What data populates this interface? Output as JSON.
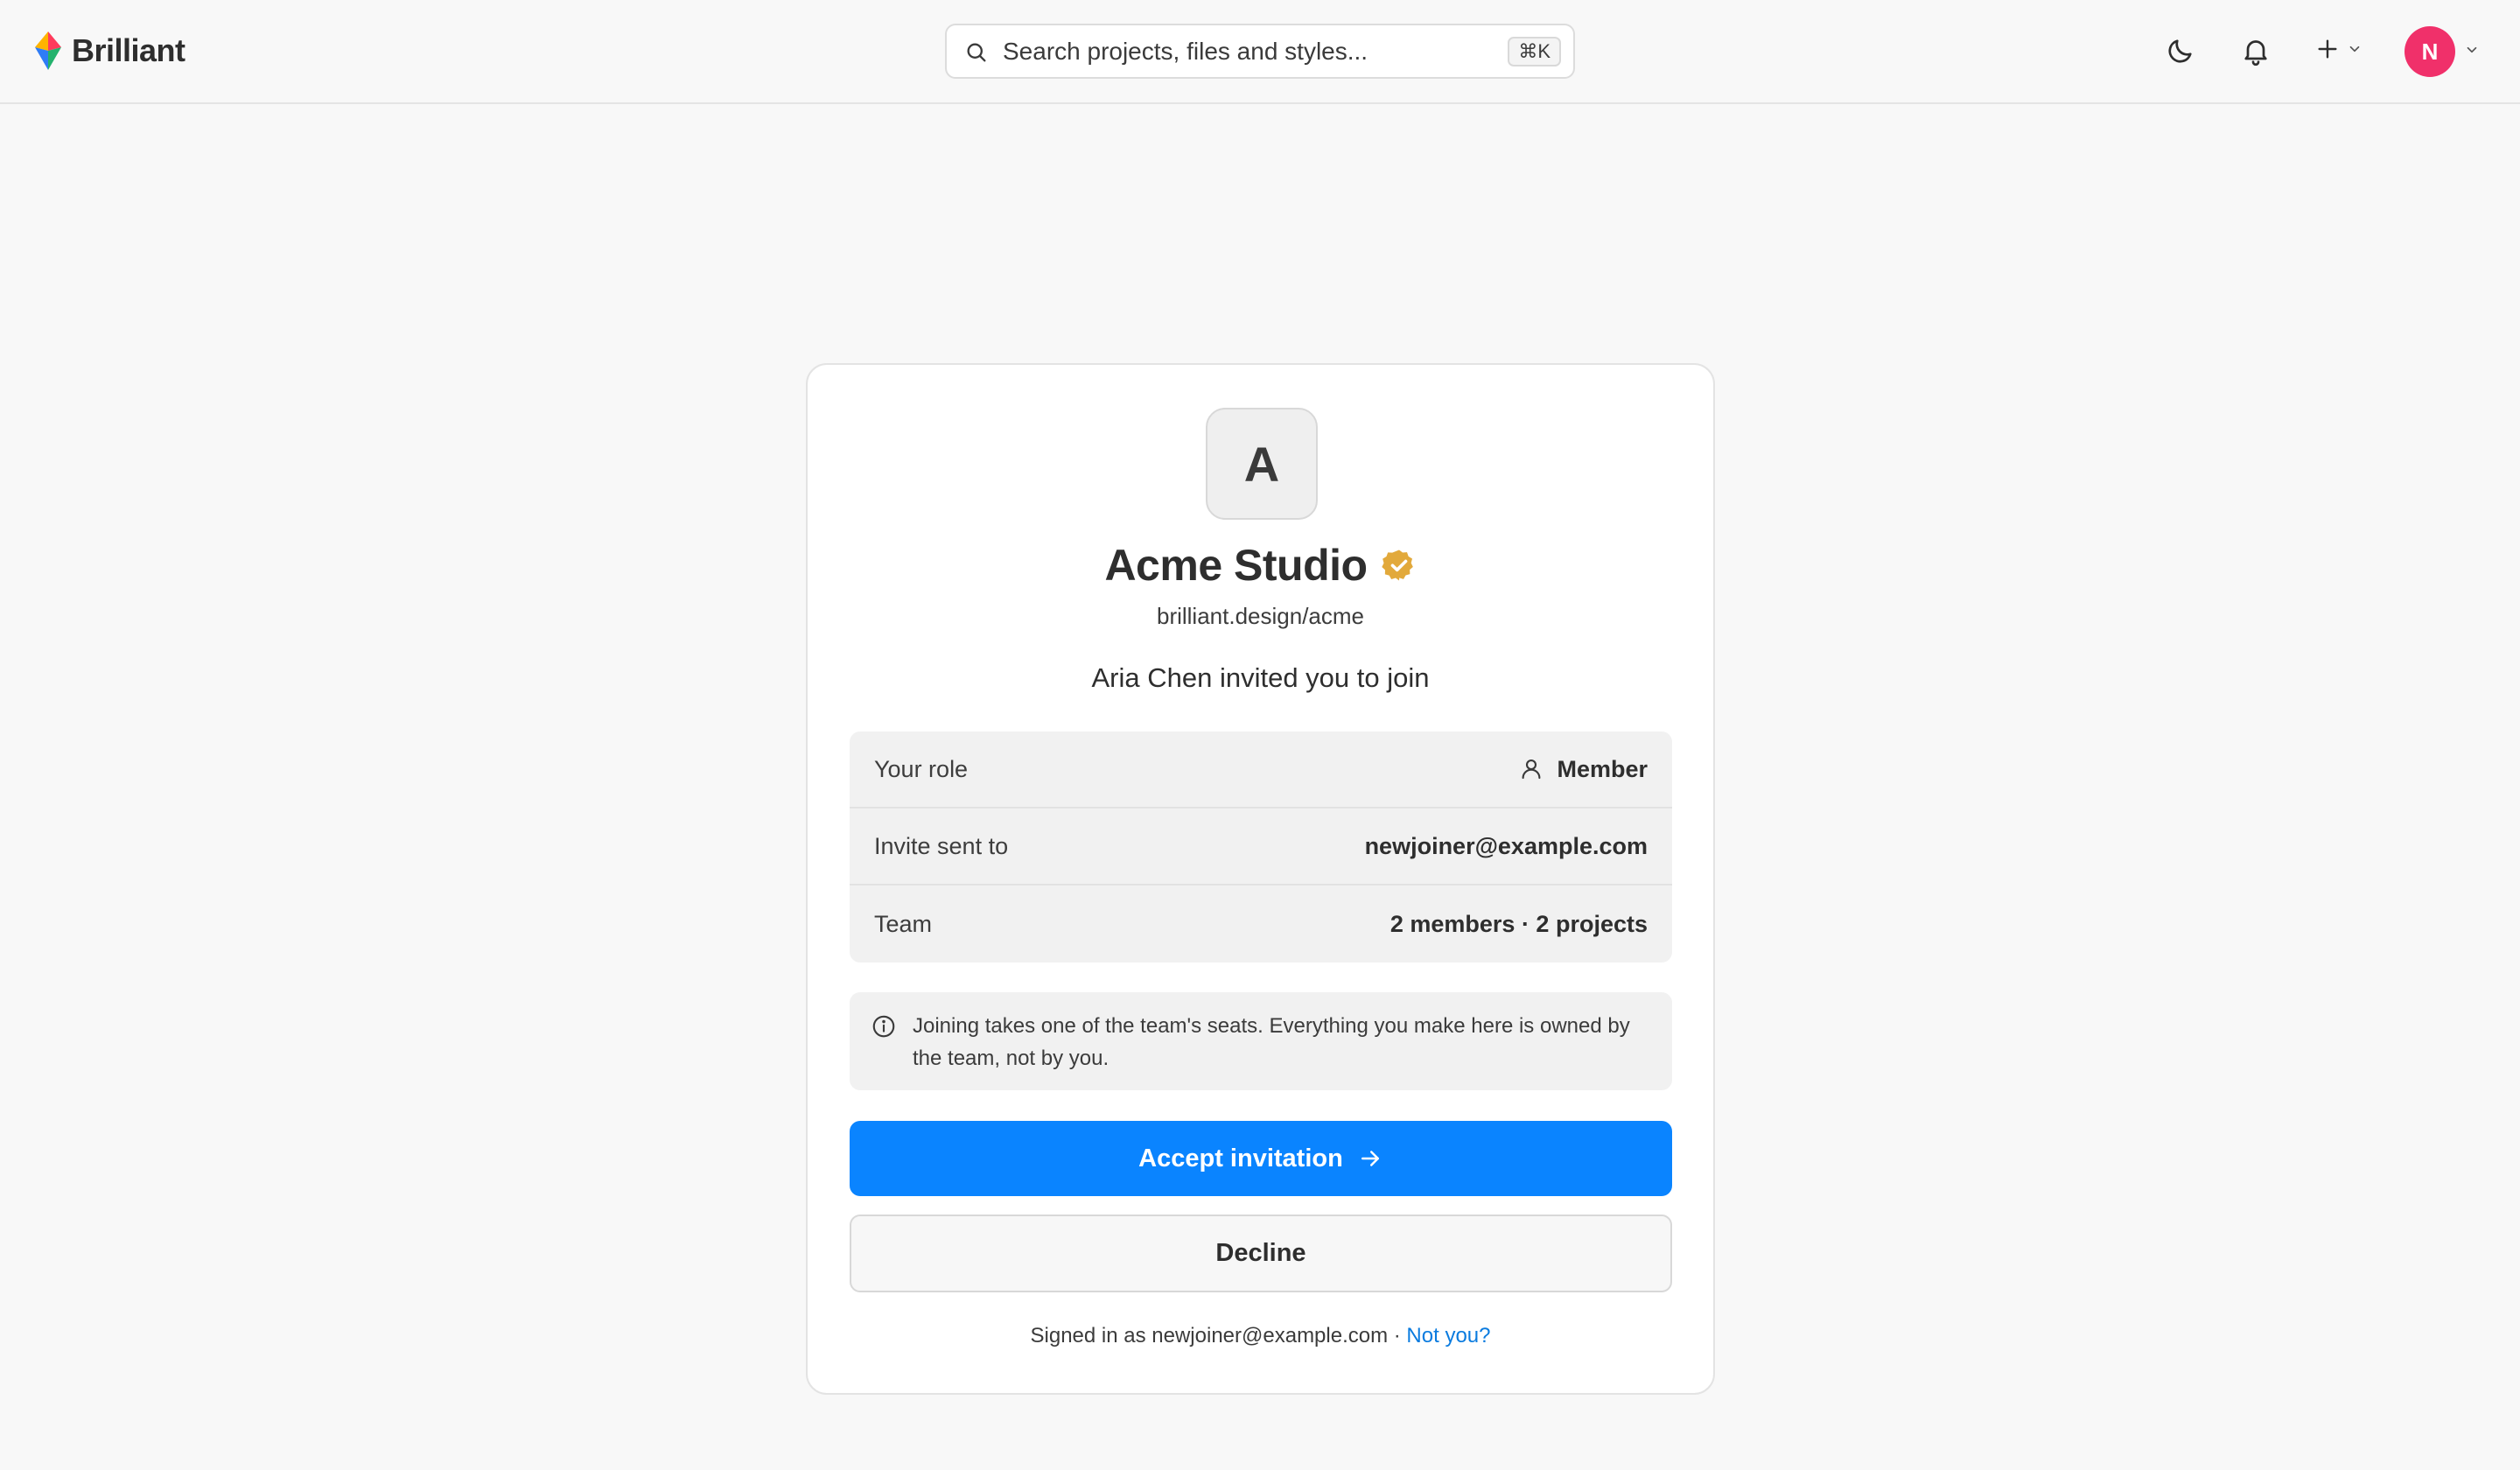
{
  "app": {
    "brand": "Brilliant"
  },
  "search": {
    "placeholder": "Search projects, files and styles...",
    "shortcut": "⌘K"
  },
  "toolbar": {
    "theme_icon": "moon-icon",
    "notifications_icon": "bell-icon",
    "create_icon": "plus-icon",
    "avatar_initial": "N",
    "avatar_color": "#f0306a"
  },
  "invite": {
    "team_initial": "A",
    "team_name": "Acme Studio",
    "verified_color": "#e2a93b",
    "team_url": "brilliant.design/acme",
    "inviter_line": "Aria Chen invited you to join",
    "details": [
      {
        "label": "Your role",
        "value": "Member",
        "icon": "user-icon"
      },
      {
        "label": "Invite sent to",
        "value": "newjoiner@example.com"
      },
      {
        "label": "Team",
        "value": "2 members · 2 projects"
      }
    ],
    "notice": "Joining takes one of the team's seats. Everything you make here is owned by the team, not by you.",
    "accept_label": "Accept invitation",
    "decline_label": "Decline",
    "signed_in_text": "Signed in as newjoiner@example.com · ",
    "not_you_label": "Not you?",
    "accent_color": "#0a84ff"
  }
}
